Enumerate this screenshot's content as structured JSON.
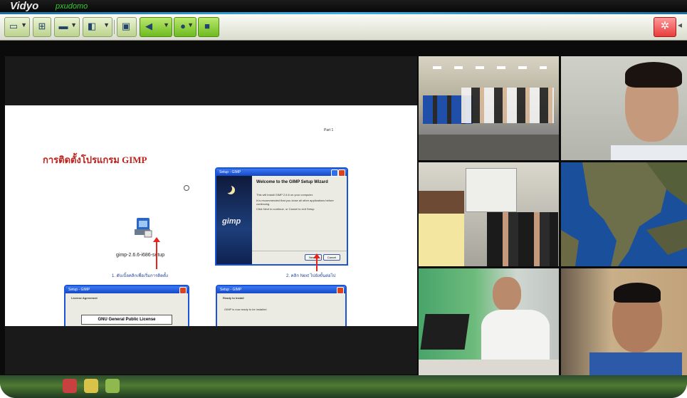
{
  "app": {
    "name": "Vidyo",
    "subtitle": "pxudomo"
  },
  "toolbar": {
    "buttons": [
      {
        "name": "layout-button",
        "icon": "window-layout-icon"
      },
      {
        "name": "grid-button",
        "icon": "grid-icon"
      },
      {
        "name": "monitor-button",
        "icon": "monitor-icon"
      },
      {
        "name": "share-button",
        "icon": "share-screen-icon"
      },
      {
        "name": "self-view-button",
        "icon": "self-view-icon"
      },
      {
        "name": "speaker-button",
        "icon": "speaker-icon"
      },
      {
        "name": "microphone-button",
        "icon": "microphone-icon"
      },
      {
        "name": "camera-button",
        "icon": "camera-icon"
      },
      {
        "name": "settings-button",
        "icon": "gear-icon"
      }
    ]
  },
  "slide": {
    "page_label": "Part 1",
    "title": "การติดตั้งโปรแกรม GIMP",
    "installer_label": "gimp-2.6.6-i686-setup",
    "caption1": "1. ดับเบิ้ลคลิกเพื่อเริ่มการติดตั้ง",
    "caption2": "2. คลิก Next ไปยังขั้นต่อไป",
    "wizard": {
      "title_bar": "Setup - GIMP",
      "heading": "Welcome to the GIMP Setup Wizard",
      "line1": "This will install GIMP 2.6.6 on your computer.",
      "line2": "It is recommended that you close all other applications before continuing.",
      "line3": "Click Next to continue, or Cancel to exit Setup.",
      "next": "Next >",
      "cancel": "Cancel",
      "logo": "gimp"
    },
    "license_win": {
      "title_bar": "Setup - GIMP",
      "heading": "License Agreement",
      "license": "GNU General Public License"
    },
    "ready_win": {
      "title_bar": "Setup - GIMP",
      "heading": "Ready to Install",
      "body": "GIMP is now ready to be installed"
    }
  },
  "participants": [
    {
      "name": "conference-room-tile"
    },
    {
      "name": "man-profile-tile"
    },
    {
      "name": "meeting-room-tile"
    },
    {
      "name": "map-tile"
    },
    {
      "name": "speaker-microphone-tile"
    },
    {
      "name": "man-webcam-tile"
    }
  ],
  "colors": {
    "accent": "#3fb0e8",
    "toolbar_green": "#6fbb1f",
    "settings_red": "#e83c3c",
    "slide_title": "#c0201a"
  }
}
